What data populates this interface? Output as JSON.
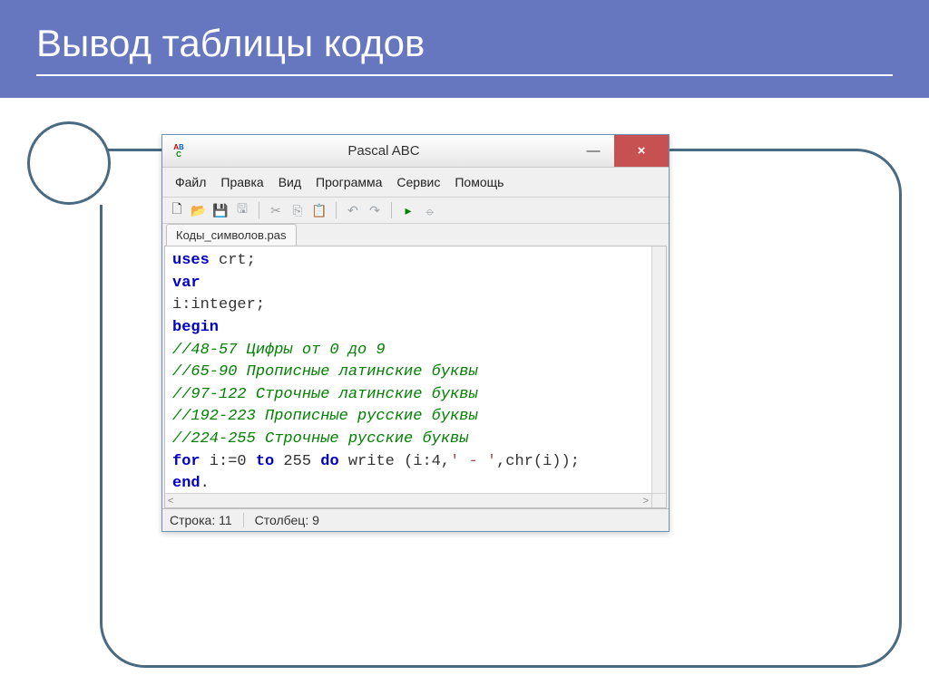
{
  "slide": {
    "title": "Вывод таблицы кодов"
  },
  "window": {
    "title": "Pascal ABC",
    "icon_letters": {
      "a": "A",
      "b": "B",
      "c": "C"
    },
    "controls": {
      "minimize": "—",
      "close": "×"
    }
  },
  "menu": {
    "items": [
      "Файл",
      "Правка",
      "Вид",
      "Программа",
      "Сервис",
      "Помощь"
    ]
  },
  "tab": {
    "name": "Коды_символов.pas"
  },
  "code": {
    "line1_kw": "uses",
    "line1_rest": " crt;",
    "line2_kw": "var",
    "line3": "i:integer;",
    "line4_kw": "begin",
    "line5_cm": "//48-57 Цифры от 0 до 9",
    "line6_cm": "//65-90 Прописные латинские буквы",
    "line7_cm": "//97-122 Строчные латинские буквы",
    "line8_cm": "//192-223 Прописные русские буквы",
    "line9_cm": "//224-255 Строчные русские буквы",
    "line10_for": "for",
    "line10_a": " i:=0 ",
    "line10_to": "to",
    "line10_b": " 255 ",
    "line10_do": "do",
    "line10_c": " write (i:4,",
    "line10_str": "' - '",
    "line10_d": ",chr(i));",
    "line11_kw": "end",
    "line11_rest": "."
  },
  "scroll": {
    "left": "<",
    "right": ">"
  },
  "status": {
    "line": "Строка: 11",
    "col": "Столбец:  9"
  },
  "icons": {
    "new": "🗋",
    "open": "📂",
    "save": "💾",
    "saveall": "🖫",
    "cut": "✂",
    "copy": "⎘",
    "paste": "📋",
    "undo": "↶",
    "redo": "↷",
    "run": "▸",
    "stop": "⦵"
  }
}
